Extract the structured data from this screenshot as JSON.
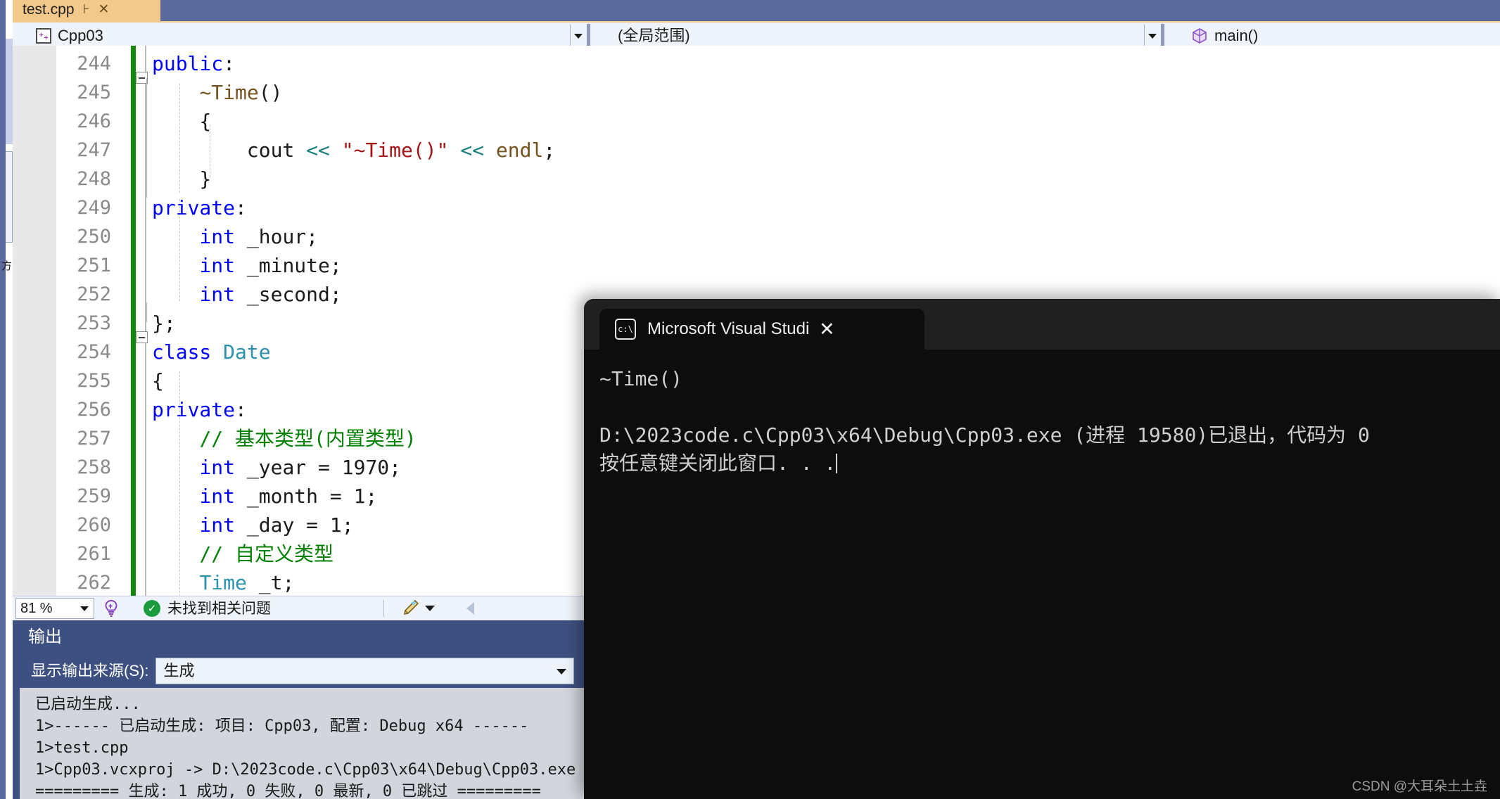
{
  "app": {
    "left_strip_text": "方"
  },
  "tab": {
    "label": "test.cpp",
    "pin_icon": "pin-icon",
    "close_icon": "close-icon"
  },
  "navbar": {
    "project": "Cpp03",
    "project_icon": "cpp-file-icon",
    "scope": "(全局范围)",
    "member": "main()",
    "member_icon": "cube-icon"
  },
  "editor": {
    "lines": [
      {
        "no": "244",
        "tokens": [
          {
            "t": "public",
            "c": "k"
          },
          {
            "t": ":",
            "c": "id"
          }
        ],
        "indent": 0
      },
      {
        "no": "245",
        "tokens": [
          {
            "t": "    ",
            "c": "id"
          },
          {
            "t": "~Time",
            "c": "fn"
          },
          {
            "t": "()",
            "c": "id"
          }
        ],
        "indent": 0
      },
      {
        "no": "246",
        "tokens": [
          {
            "t": "    {",
            "c": "id"
          }
        ],
        "indent": 0
      },
      {
        "no": "247",
        "tokens": [
          {
            "t": "        ",
            "c": "id"
          },
          {
            "t": "cout ",
            "c": "id"
          },
          {
            "t": "<<",
            "c": "op"
          },
          {
            "t": " ",
            "c": "id"
          },
          {
            "t": "\"~Time()\"",
            "c": "st"
          },
          {
            "t": " ",
            "c": "id"
          },
          {
            "t": "<<",
            "c": "op"
          },
          {
            "t": " ",
            "c": "id"
          },
          {
            "t": "endl",
            "c": "fn"
          },
          {
            "t": ";",
            "c": "id"
          }
        ],
        "indent": 0
      },
      {
        "no": "248",
        "tokens": [
          {
            "t": "    }",
            "c": "id"
          }
        ],
        "indent": 0
      },
      {
        "no": "249",
        "tokens": [
          {
            "t": "private",
            "c": "k"
          },
          {
            "t": ":",
            "c": "id"
          }
        ],
        "indent": 0
      },
      {
        "no": "250",
        "tokens": [
          {
            "t": "    ",
            "c": "id"
          },
          {
            "t": "int",
            "c": "k"
          },
          {
            "t": " _hour;",
            "c": "id"
          }
        ],
        "indent": 0
      },
      {
        "no": "251",
        "tokens": [
          {
            "t": "    ",
            "c": "id"
          },
          {
            "t": "int",
            "c": "k"
          },
          {
            "t": " _minute;",
            "c": "id"
          }
        ],
        "indent": 0
      },
      {
        "no": "252",
        "tokens": [
          {
            "t": "    ",
            "c": "id"
          },
          {
            "t": "int",
            "c": "k"
          },
          {
            "t": " _second;",
            "c": "id"
          }
        ],
        "indent": 0
      },
      {
        "no": "253",
        "tokens": [
          {
            "t": "};",
            "c": "id"
          }
        ],
        "indent": 0
      },
      {
        "no": "254",
        "tokens": [
          {
            "t": "class",
            "c": "k"
          },
          {
            "t": " ",
            "c": "id"
          },
          {
            "t": "Date",
            "c": "t"
          }
        ],
        "indent": 0
      },
      {
        "no": "255",
        "tokens": [
          {
            "t": "{",
            "c": "id"
          }
        ],
        "indent": 0
      },
      {
        "no": "256",
        "tokens": [
          {
            "t": "private",
            "c": "k"
          },
          {
            "t": ":",
            "c": "id"
          }
        ],
        "indent": 0
      },
      {
        "no": "257",
        "tokens": [
          {
            "t": "    ",
            "c": "id"
          },
          {
            "t": "// 基本类型(内置类型)",
            "c": "cm"
          }
        ],
        "indent": 0
      },
      {
        "no": "258",
        "tokens": [
          {
            "t": "    ",
            "c": "id"
          },
          {
            "t": "int",
            "c": "k"
          },
          {
            "t": " _year = 1970;",
            "c": "id"
          }
        ],
        "indent": 0
      },
      {
        "no": "259",
        "tokens": [
          {
            "t": "    ",
            "c": "id"
          },
          {
            "t": "int",
            "c": "k"
          },
          {
            "t": " _month = 1;",
            "c": "id"
          }
        ],
        "indent": 0
      },
      {
        "no": "260",
        "tokens": [
          {
            "t": "    ",
            "c": "id"
          },
          {
            "t": "int",
            "c": "k"
          },
          {
            "t": " _day = 1;",
            "c": "id"
          }
        ],
        "indent": 0
      },
      {
        "no": "261",
        "tokens": [
          {
            "t": "    ",
            "c": "id"
          },
          {
            "t": "// 自定义类型",
            "c": "cm"
          }
        ],
        "indent": 0
      },
      {
        "no": "262",
        "tokens": [
          {
            "t": "    ",
            "c": "id"
          },
          {
            "t": "Time",
            "c": "t"
          },
          {
            "t": " _t;",
            "c": "id"
          }
        ],
        "indent": 0
      }
    ]
  },
  "statusbar": {
    "zoom": "81 %",
    "bulb_icon": "lightbulb-wrench-icon",
    "status_icon": "check-circle-icon",
    "status_text": "未找到相关问题",
    "brush_icon": "brush-icon"
  },
  "output": {
    "title": "输出",
    "source_label": "显示输出来源(S):",
    "source_value": "生成",
    "lines": [
      "已启动生成...",
      "1>------ 已启动生成: 项目: Cpp03, 配置: Debug x64 ------",
      "1>test.cpp",
      "1>Cpp03.vcxproj -> D:\\2023code.c\\Cpp03\\x64\\Debug\\Cpp03.exe",
      "========= 生成: 1 成功, 0 失败, 0 最新, 0 已跳过 ========="
    ]
  },
  "console": {
    "tab_icon": "cmd-prompt-icon",
    "tab_title": "Microsoft Visual Studio 调试控",
    "close_icon": "close-icon",
    "newtab_icon": "plus-icon",
    "chevron_icon": "chevron-down-icon",
    "lines": [
      "~Time()",
      "",
      "D:\\2023code.c\\Cpp03\\x64\\Debug\\Cpp03.exe (进程 19580)已退出，代码为 0",
      "按任意键关闭此窗口. . ."
    ],
    "watermark": "CSDN @大耳朵土土垚"
  },
  "colors": {
    "tab_active": "#f2c98a",
    "titlebar": "#5b6b9c",
    "output_panel": "#3e5081",
    "change_bar": "#14870b",
    "console_bg": "#0d0d0d"
  }
}
